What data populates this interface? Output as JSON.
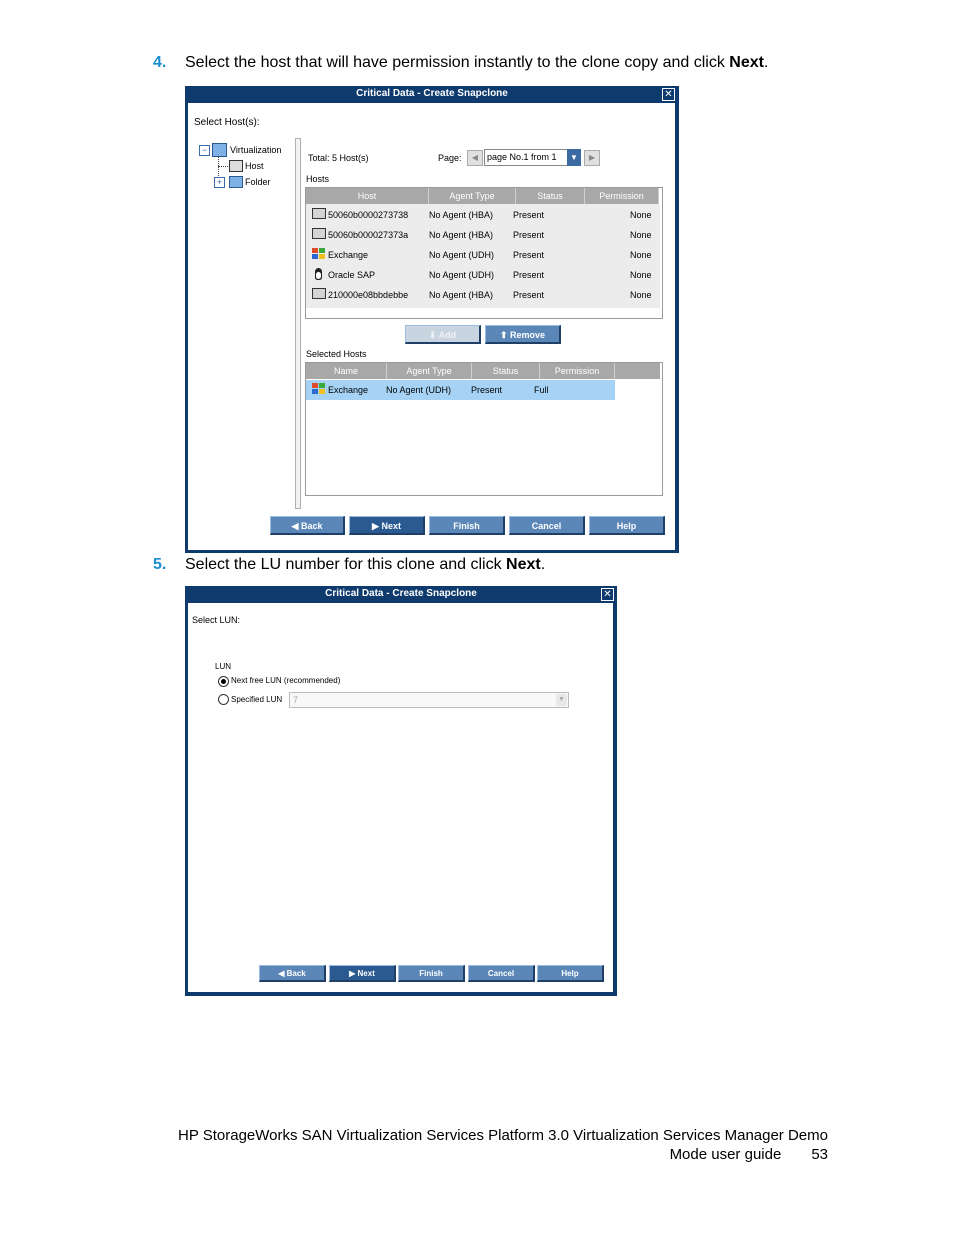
{
  "steps": [
    {
      "number": "4.",
      "text": "Select the host that will have permission instantly to the clone copy and click ",
      "bold": "Next",
      "end": "."
    },
    {
      "number": "5.",
      "text": "Select the LU number for this clone and click ",
      "bold": "Next",
      "end": "."
    }
  ],
  "dialog1": {
    "title": "Critical Data - Create Snapclone",
    "prompt": "Select Host(s):",
    "tree": {
      "root": "Virtualization",
      "child1": "Host",
      "child2": "Folder"
    },
    "total": "Total: 5 Host(s)",
    "page_label": "Page:",
    "page_value": "page No.1 from 1",
    "hosts_label": "Hosts",
    "hosts_columns": [
      "Host",
      "Agent Type",
      "Status",
      "Permission"
    ],
    "hosts_rows": [
      {
        "icon": "server-icon",
        "host": "50060b0000273738",
        "agent": "No Agent (HBA)",
        "status": "Present",
        "permission": "None"
      },
      {
        "icon": "server-icon",
        "host": "50060b000027373a",
        "agent": "No Agent (HBA)",
        "status": "Present",
        "permission": "None"
      },
      {
        "icon": "windows-icon",
        "host": "Exchange",
        "agent": "No Agent (UDH)",
        "status": "Present",
        "permission": "None"
      },
      {
        "icon": "linux-icon",
        "host": "Oracle SAP",
        "agent": "No Agent (UDH)",
        "status": "Present",
        "permission": "None"
      },
      {
        "icon": "server-icon",
        "host": "210000e08bbdebbe",
        "agent": "No Agent (HBA)",
        "status": "Present",
        "permission": "None"
      }
    ],
    "add_label": "Add",
    "remove_label": "Remove",
    "selected_label": "Selected Hosts",
    "selected_columns": [
      "Name",
      "Agent Type",
      "Status",
      "Permission"
    ],
    "selected_rows": [
      {
        "icon": "windows-icon",
        "name": "Exchange",
        "agent": "No Agent (UDH)",
        "status": "Present",
        "permission": "Full"
      }
    ],
    "buttons": [
      "Back",
      "Next",
      "Finish",
      "Cancel",
      "Help"
    ]
  },
  "dialog2": {
    "title": "Critical Data - Create Snapclone",
    "prompt": "Select LUN:",
    "lun_label": "LUN",
    "option1": "Next free LUN (recommended)",
    "option2": "Specified LUN",
    "lun_value": "7",
    "buttons": [
      "Back",
      "Next",
      "Finish",
      "Cancel",
      "Help"
    ]
  },
  "footer": {
    "line1": "HP StorageWorks SAN Virtualization Services Platform 3.0 Virtualization Services Manager Demo",
    "line2": "Mode user guide",
    "page_number": "53"
  },
  "colors": {
    "step_number": "#1a8fd0",
    "dialog_frame": "#0e3a6e",
    "button": "#5b87b8",
    "selection": "#a6d3f5",
    "grid_header": "#a8a8a8"
  }
}
